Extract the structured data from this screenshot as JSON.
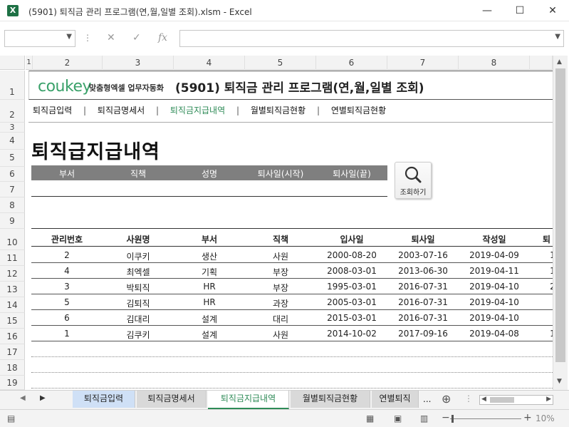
{
  "window": {
    "title": "(5901) 퇴직금 관리 프로그램(연,월,일별 조회).xlsm - Excel",
    "app_icon": "X",
    "minimize": "—",
    "maximize": "☐",
    "close": "✕"
  },
  "formula_bar": {
    "cancel_icon": "✕",
    "enter_icon": "✓",
    "fx_label": "fx",
    "value": ""
  },
  "columns": [
    "1",
    "2",
    "3",
    "4",
    "5",
    "6",
    "7",
    "8"
  ],
  "rows": [
    "1",
    "2",
    "3",
    "4",
    "5",
    "6",
    "7",
    "8",
    "9",
    "10",
    "11",
    "12",
    "13",
    "14",
    "15",
    "16",
    "17",
    "18",
    "19"
  ],
  "brand": {
    "logo": "coukey",
    "tagline": "맞춤형엑셀 업무자동화",
    "app_title": "(5901) 퇴직금 관리 프로그램(연,월,일별 조회)"
  },
  "menu": [
    {
      "label": "퇴직금입력",
      "active": false
    },
    {
      "label": "퇴직금명세서",
      "active": false
    },
    {
      "label": "퇴직금지급내역",
      "active": true
    },
    {
      "label": "월별퇴직금현황",
      "active": false
    },
    {
      "label": "연별퇴직금현황",
      "active": false
    }
  ],
  "menu_separator": "|",
  "page_title": "퇴직급지급내역",
  "filter": {
    "headers": [
      "부서",
      "직책",
      "성명",
      "퇴사일(시작)",
      "퇴사일(끝)"
    ],
    "search_button": "조회하기"
  },
  "table": {
    "headers": [
      "관리번호",
      "사원명",
      "부서",
      "직책",
      "입사일",
      "퇴사일",
      "작성일",
      "퇴"
    ],
    "rows": [
      [
        "2",
        "이쿠키",
        "생산",
        "사원",
        "2000-08-20",
        "2003-07-16",
        "2019-04-09",
        "1"
      ],
      [
        "4",
        "최엑셀",
        "기획",
        "부장",
        "2008-03-01",
        "2013-06-30",
        "2019-04-11",
        "1"
      ],
      [
        "3",
        "박퇴직",
        "HR",
        "부장",
        "1995-03-01",
        "2016-07-31",
        "2019-04-10",
        "2"
      ],
      [
        "5",
        "김퇴직",
        "HR",
        "과장",
        "2005-03-01",
        "2016-07-31",
        "2019-04-10",
        ""
      ],
      [
        "6",
        "김대리",
        "설계",
        "대리",
        "2015-03-01",
        "2016-07-31",
        "2019-04-10",
        ""
      ],
      [
        "1",
        "김쿠키",
        "설계",
        "사원",
        "2014-10-02",
        "2017-09-16",
        "2019-04-08",
        "1"
      ]
    ]
  },
  "sheet_tabs": [
    {
      "label": "퇴직금입력",
      "color": "#cfe0f6",
      "active": false
    },
    {
      "label": "퇴직금명세서",
      "color": "#d9d9d9",
      "active": false
    },
    {
      "label": "퇴직금지급내역",
      "color": "#ffffff",
      "active": true
    },
    {
      "label": "월별퇴직금현황",
      "color": "#d9d9d9",
      "active": false
    },
    {
      "label": "연별퇴직",
      "color": "#d9d9d9",
      "active": false
    }
  ],
  "tabs_more": "...",
  "add_sheet_icon": "⊕",
  "status": {
    "zoom": "10%",
    "zoom_minus": "−",
    "zoom_plus": "+"
  },
  "colors": {
    "accent": "#2e8b57",
    "excel_green": "#1e7145",
    "filter_header_bg": "#7f7f7f"
  }
}
